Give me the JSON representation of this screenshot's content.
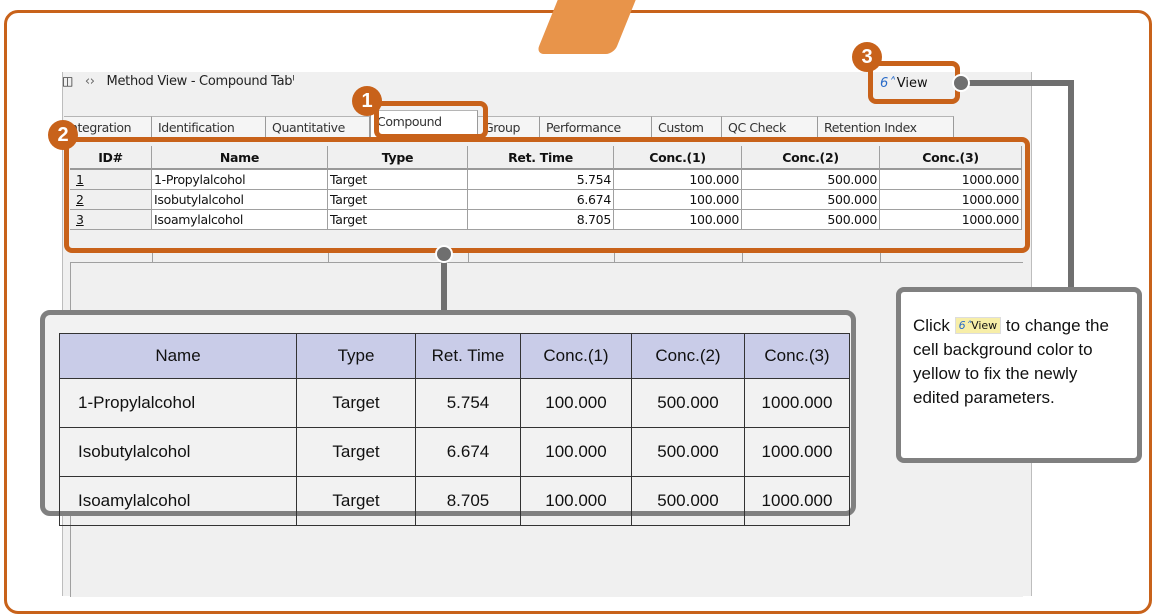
{
  "window": {
    "title": "Method View - Compound Tabˡ"
  },
  "tabs": [
    "ntegration",
    "Identification",
    "Quantitative",
    "Compound",
    "Group",
    "Performance",
    "Custom",
    "QC Check",
    "Retention Index"
  ],
  "view_button": {
    "label": "View",
    "icon": "glasses-icon"
  },
  "badges": {
    "one": "1",
    "two": "2",
    "three": "3"
  },
  "grid": {
    "headers": [
      "ID#",
      "Name",
      "Type",
      "Ret. Time",
      "Conc.(1)",
      "Conc.(2)",
      "Conc.(3)"
    ],
    "rows": [
      [
        "1",
        "1-Propylalcohol",
        "Target",
        "5.754",
        "100.000",
        "500.000",
        "1000.000"
      ],
      [
        "2",
        "Isobutylalcohol",
        "Target",
        "6.674",
        "100.000",
        "500.000",
        "1000.000"
      ],
      [
        "3",
        "Isoamylalcohol",
        "Target",
        "8.705",
        "100.000",
        "500.000",
        "1000.000"
      ]
    ]
  },
  "zoom_table": {
    "headers": [
      "Name",
      "Type",
      "Ret. Time",
      "Conc.(1)",
      "Conc.(2)",
      "Conc.(3)"
    ],
    "rows": [
      [
        "1-Propylalcohol",
        "Target",
        "5.754",
        "100.000",
        "500.000",
        "1000.000"
      ],
      [
        "Isobutylalcohol",
        "Target",
        "6.674",
        "100.000",
        "500.000",
        "1000.000"
      ],
      [
        "Isoamylalcohol",
        "Target",
        "8.705",
        "100.000",
        "500.000",
        "1000.000"
      ]
    ]
  },
  "note": {
    "prefix": "Click",
    "button_label": "View",
    "suffix": "to change the cell background color to yellow to fix the newly edited parameters."
  },
  "colors": {
    "accent": "#c8621a",
    "callout": "#808080",
    "header_fill": "#c9cce8",
    "view_highlight": "#f7eea8"
  }
}
